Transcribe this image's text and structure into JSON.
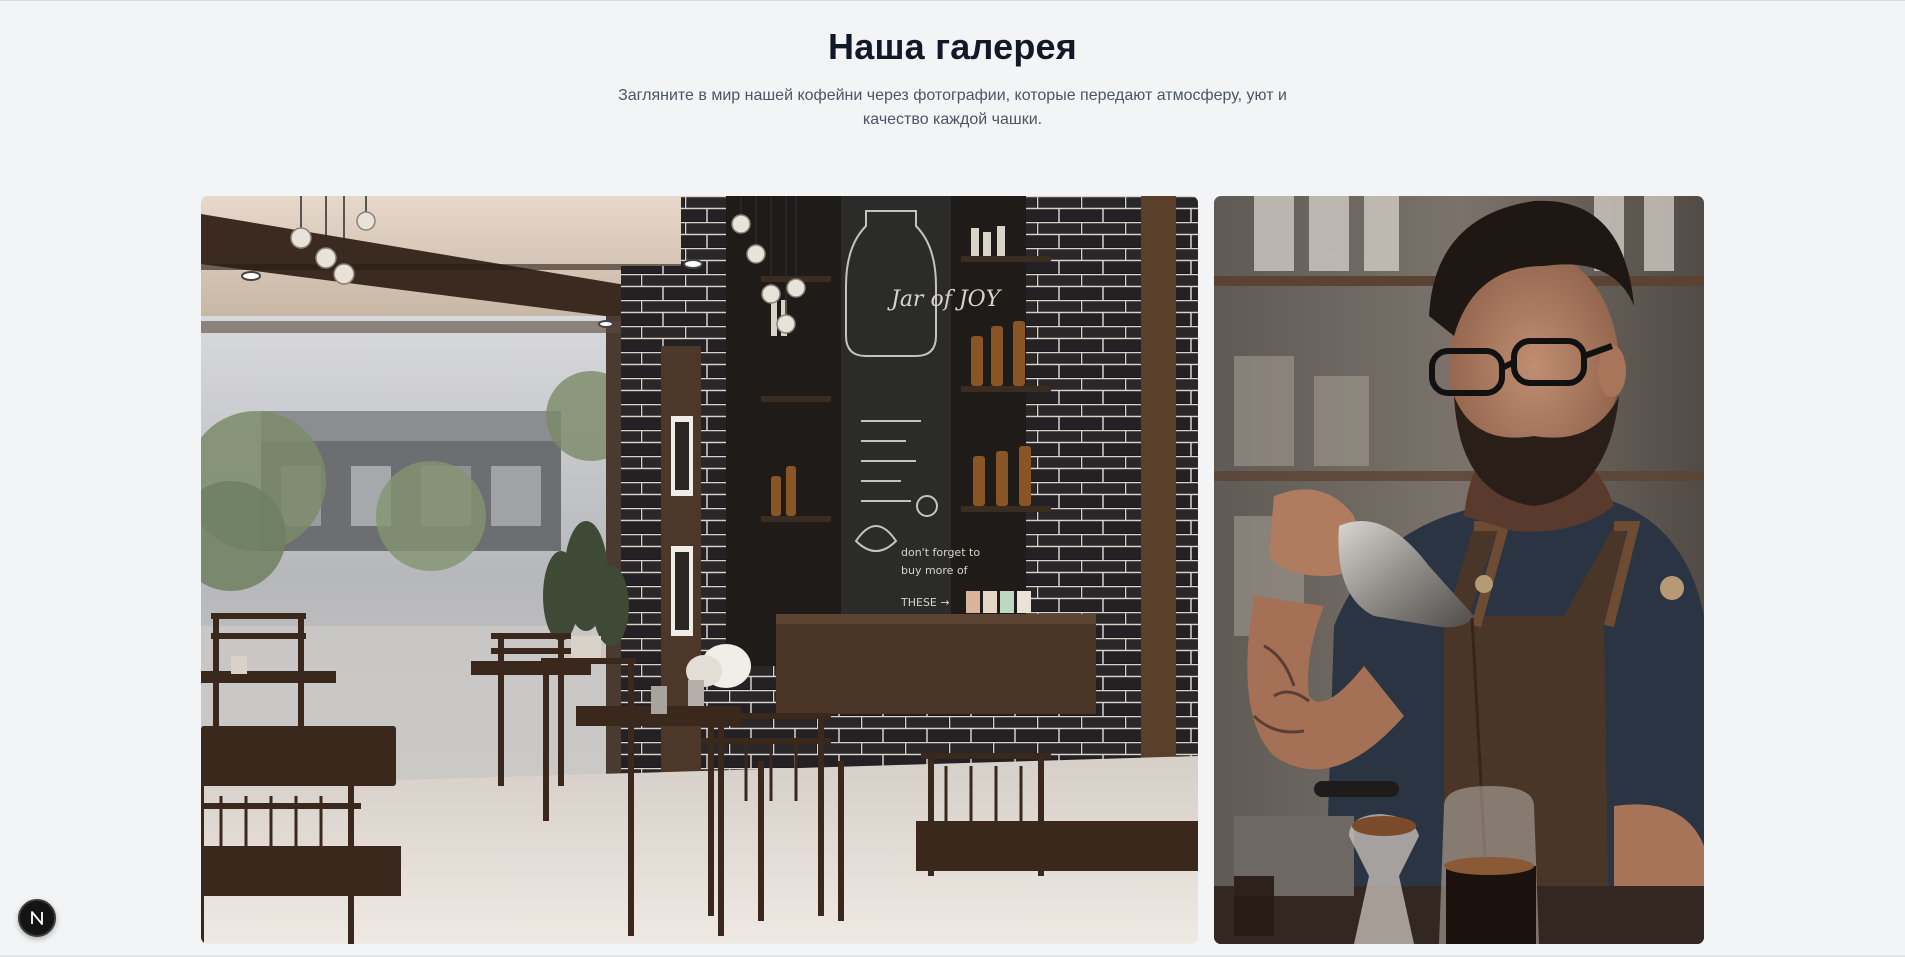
{
  "gallery": {
    "title": "Наша галерея",
    "subtitle": "Загляните в мир нашей кофейни через фотографии, которые передают атмосферу, уют и качество каждой чашки.",
    "images": [
      {
        "label": "cafe-interior"
      },
      {
        "label": "barista-pouring-coffee"
      }
    ],
    "chalkboard_lines": [
      "Grocery list",
      "please buy",
      "more candy!",
      "don't forget to",
      "buy more of",
      "THESE →"
    ],
    "chalkboard_jar": "Jar of JOY"
  },
  "dev_badge": {
    "letter": "N",
    "icon": "nextjs-logo-icon"
  },
  "colors": {
    "background": "#f3f4f6",
    "title": "#111827",
    "text": "#4b5563"
  }
}
